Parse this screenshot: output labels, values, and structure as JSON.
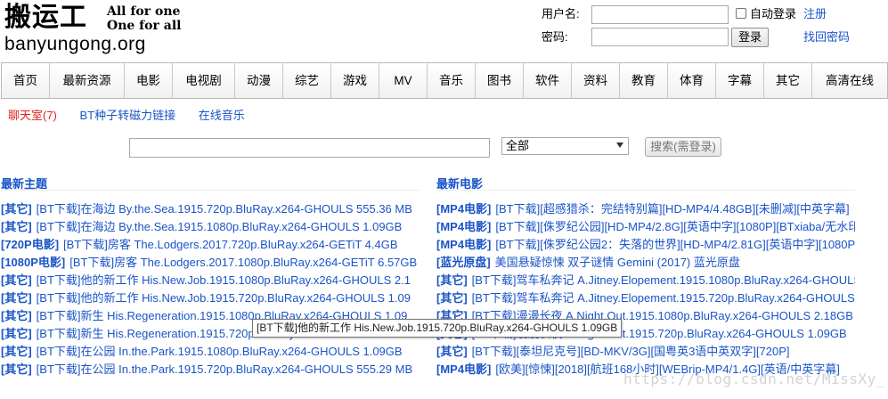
{
  "header": {
    "logo_cn": "搬运工",
    "slogan_line1": "All for one",
    "slogan_line2": "One for all",
    "logo_en": "banyungong.org"
  },
  "login": {
    "username_label": "用户名:",
    "password_label": "密码:",
    "auto_login_label": "自动登录",
    "register_link": "注册",
    "login_button": "登录",
    "forgot_link": "找回密码"
  },
  "nav": [
    "首页",
    "最新资源",
    "电影",
    "电视剧",
    "动漫",
    "综艺",
    "游戏",
    "MV",
    "音乐",
    "图书",
    "软件",
    "资料",
    "教育",
    "体育",
    "字幕",
    "其它",
    "高清在线"
  ],
  "sublinks": {
    "chat": "聊天室(7)",
    "bt_convert": "BT种子转磁力链接",
    "online_music": "在线音乐"
  },
  "search": {
    "value": "",
    "select_value": "全部",
    "button": "搜索(需登录)"
  },
  "latest_topics": {
    "title": "最新主题",
    "rows": [
      {
        "tag": "[其它]",
        "text": "[BT下载]在海边 By.the.Sea.1915.720p.BluRay.x264-GHOULS 555.36 MB"
      },
      {
        "tag": "[其它]",
        "text": "[BT下载]在海边 By.the.Sea.1915.1080p.BluRay.x264-GHOULS 1.09GB"
      },
      {
        "tag": "[720P电影]",
        "text": "[BT下载]房客 The.Lodgers.2017.720p.BluRay.x264-GETiT 4.4GB"
      },
      {
        "tag": "[1080P电影]",
        "text": "[BT下载]房客 The.Lodgers.2017.1080p.BluRay.x264-GETiT 6.57GB"
      },
      {
        "tag": "[其它]",
        "text": "[BT下载]他的新工作 His.New.Job.1915.1080p.BluRay.x264-GHOULS 2.1"
      },
      {
        "tag": "[其它]",
        "text": "[BT下载]他的新工作 His.New.Job.1915.720p.BluRay.x264-GHOULS 1.09"
      },
      {
        "tag": "[其它]",
        "text": "[BT下载]新生 His.Regeneration.1915.1080p.BluRay.x264-GHOULS 1.09"
      },
      {
        "tag": "[其它]",
        "text": "[BT下载]新生 His.Regeneration.1915.720p.BluRay.x264-GHOULS 1.09GB"
      },
      {
        "tag": "[其它]",
        "text": "[BT下载]在公园 In.the.Park.1915.1080p.BluRay.x264-GHOULS 1.09GB"
      },
      {
        "tag": "[其它]",
        "text": "[BT下载]在公园 In.the.Park.1915.720p.BluRay.x264-GHOULS 555.29 MB"
      }
    ]
  },
  "latest_movies": {
    "title": "最新电影",
    "rows": [
      {
        "tag": "[MP4电影]",
        "text": "[BT下载][超感猎杀：完结特别篇][HD-MP4/4.48GB][未删减][中英字幕]"
      },
      {
        "tag": "[MP4电影]",
        "text": "[BT下载][侏罗纪公园][HD-MP4/2.8G][英语中字][1080P][BTxiaba/无水印]"
      },
      {
        "tag": "[MP4电影]",
        "text": "[BT下载][侏罗纪公园2：失落的世界][HD-MP4/2.81G][英语中字][1080P]"
      },
      {
        "tag": "[蓝光原盘]",
        "text": "美国悬疑惊悚 双子谜情 Gemini (2017) 蓝光原盘"
      },
      {
        "tag": "[其它]",
        "text": "[BT下载]驾车私奔记 A.Jitney.Elopement.1915.1080p.BluRay.x264-GHOULS"
      },
      {
        "tag": "[其它]",
        "text": "[BT下载]驾车私奔记 A.Jitney.Elopement.1915.720p.BluRay.x264-GHOULS"
      },
      {
        "tag": "[其它]",
        "text": "[BT下载]漫漫长夜 A.Night.Out.1915.1080p.BluRay.x264-GHOULS 2.18GB"
      },
      {
        "tag": "[其它]",
        "text": "[BT下载]漫漫长夜 A.Night.Out.1915.720p.BluRay.x264-GHOULS 1.09GB"
      },
      {
        "tag": "[其它]",
        "text": "[BT下载][泰坦尼克号][BD-MKV/3G][国粤英3语中英双字][720P]"
      },
      {
        "tag": "[MP4电影]",
        "text": "[欧美][惊悚][2018][航班168小时][WEBrip-MP4/1.4G][英语/中英字幕]"
      }
    ]
  },
  "tooltip": "[BT下载]他的新工作 His.New.Job.1915.720p.BluRay.x264-GHOULS 1.09GB",
  "watermark": "https://blog.csdn.net/MissXy_",
  "colors": {
    "link": "#1a54c8",
    "chat": "#e0201d"
  }
}
